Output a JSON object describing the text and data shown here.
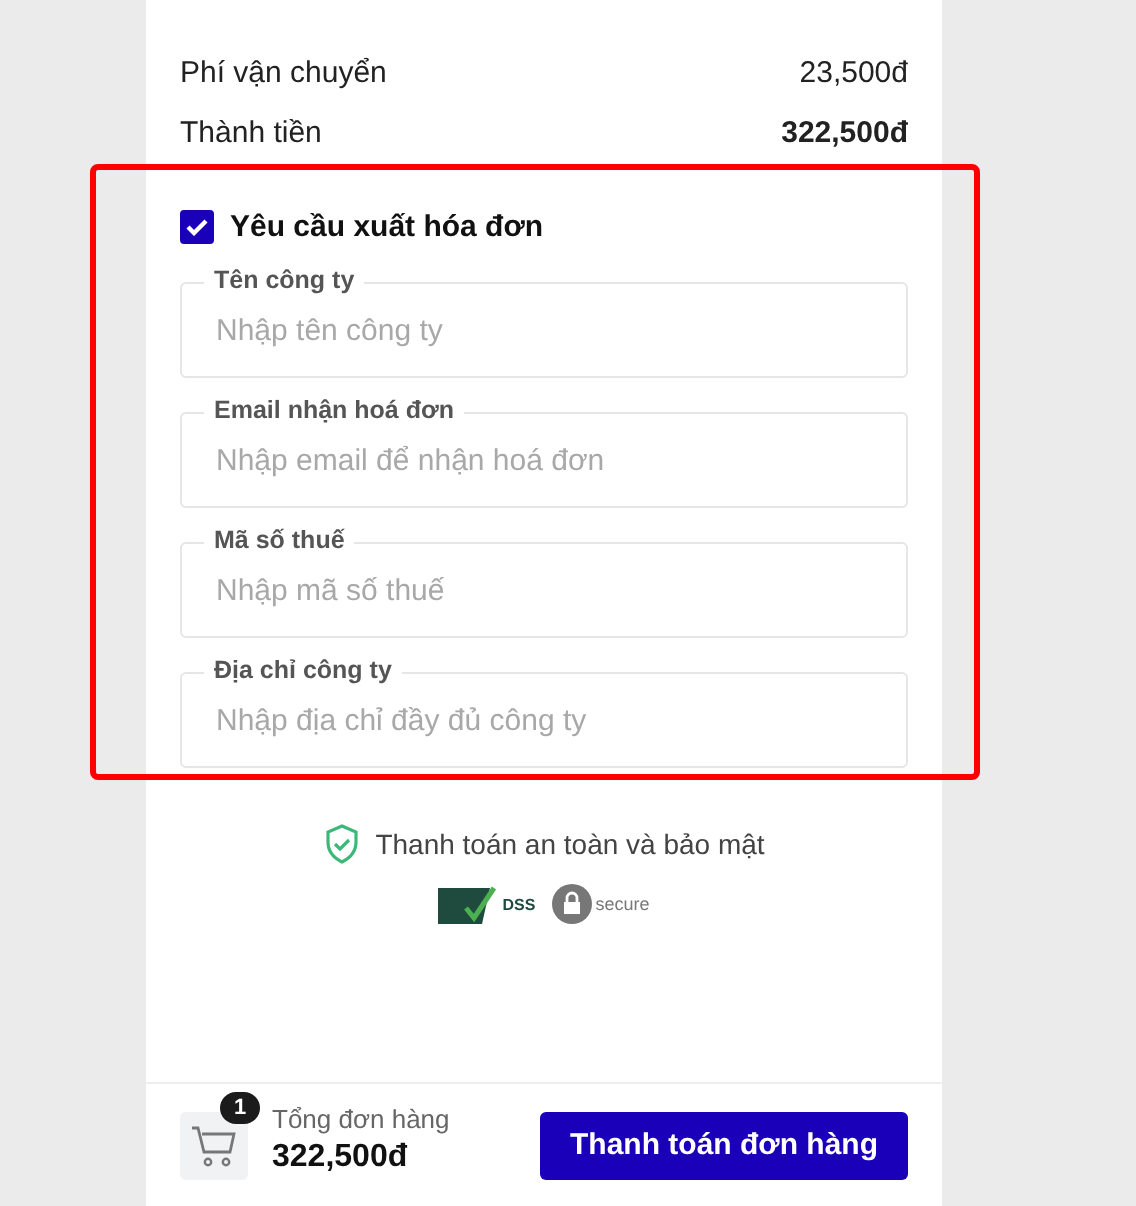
{
  "summary": [
    {
      "label": "Phí vận chuyển",
      "value": "23,500đ",
      "kind": "normal"
    },
    {
      "label": "Thành tiền",
      "value": "322,500đ",
      "kind": "total"
    }
  ],
  "invoice": {
    "label": "Yêu cầu xuất hóa đơn",
    "checked": true,
    "fields": [
      {
        "label": "Tên công ty",
        "placeholder": "Nhập tên công ty"
      },
      {
        "label": "Email nhận hoá đơn",
        "placeholder": "Nhập email để nhận hoá đơn"
      },
      {
        "label": "Mã số thuế",
        "placeholder": "Nhập mã số thuế"
      },
      {
        "label": "Địa chỉ công ty",
        "placeholder": "Nhập địa chỉ đầy đủ công ty"
      }
    ]
  },
  "security": {
    "text": "Thanh toán an toàn và bảo mật",
    "badges": [
      "DSS",
      "secure"
    ]
  },
  "footer": {
    "cart_count": "1",
    "total_label": "Tổng đơn hàng",
    "total": "322,500đ",
    "button": "Thanh toán đơn hàng"
  }
}
